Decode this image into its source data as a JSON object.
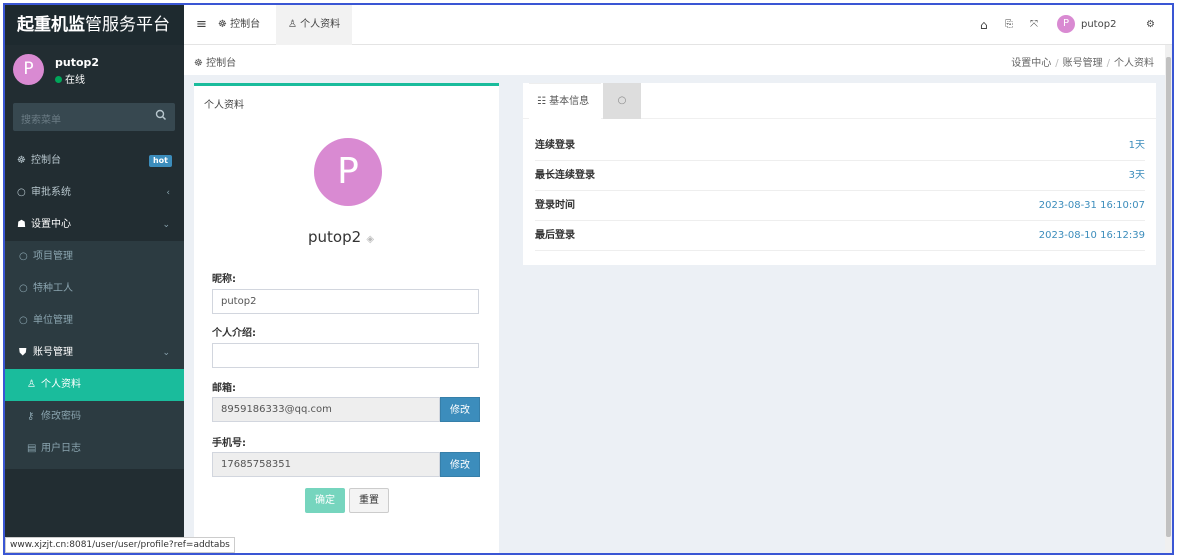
{
  "brand": {
    "bold": "起重机监",
    "rest": "管服务平台"
  },
  "user": {
    "initial": "P",
    "name": "putop2",
    "status": "在线"
  },
  "search": {
    "placeholder": "搜索菜单"
  },
  "sidebar": {
    "items": [
      {
        "label": "控制台",
        "badge": "hot"
      },
      {
        "label": "审批系统"
      },
      {
        "label": "设置中心"
      },
      {
        "label": "项目管理"
      },
      {
        "label": "特种工人"
      },
      {
        "label": "单位管理"
      },
      {
        "label": "账号管理"
      },
      {
        "label": "个人资料"
      },
      {
        "label": "修改密码"
      },
      {
        "label": "用户日志"
      }
    ]
  },
  "topbar": {
    "tabs": [
      {
        "label": "控制台"
      },
      {
        "label": "个人资料"
      }
    ],
    "username": "putop2"
  },
  "crumb": {
    "home": "控制台",
    "trail": [
      "设置中心",
      "账号管理",
      "个人资料"
    ]
  },
  "profile": {
    "card_title": "个人资料",
    "avatar_initial": "P",
    "username": "putop2",
    "nickname_label": "昵称:",
    "nickname_value": "putop2",
    "intro_label": "个人介绍:",
    "intro_value": "",
    "email_label": "邮箱:",
    "email_value": "8959186333@qq.com",
    "email_btn": "修改",
    "phone_label": "手机号:",
    "phone_value": "17685758351",
    "phone_btn": "修改",
    "ok_btn": "确定",
    "reset_btn": "重置"
  },
  "info": {
    "tab_label": "基本信息",
    "rows": [
      {
        "key": "连续登录",
        "value": "1天"
      },
      {
        "key": "最长连续登录",
        "value": "3天"
      },
      {
        "key": "登录时间",
        "value": "2023-08-31 16:10:07"
      },
      {
        "key": "最后登录",
        "value": "2023-08-10 16:12:39"
      }
    ]
  },
  "status_url": "www.xjzjt.cn:8081/user/user/profile?ref=addtabs"
}
